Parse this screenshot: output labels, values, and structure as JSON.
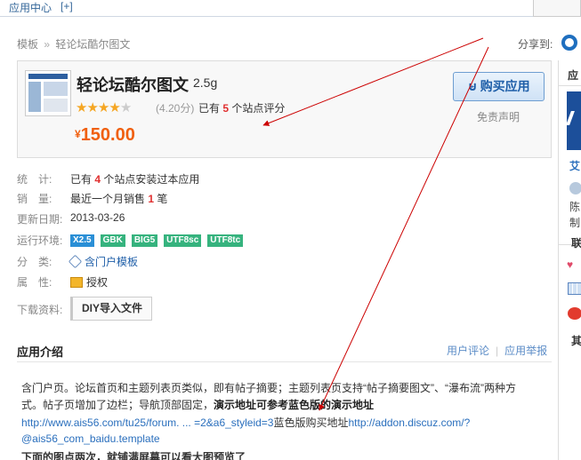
{
  "topbar": {
    "title": "应用中心",
    "add": "[+]"
  },
  "breadcrumb": {
    "home": "模板",
    "separator": "»",
    "current": "轻论坛酷尔图文"
  },
  "share": {
    "label": "分享到:",
    "icon": "qq-icon"
  },
  "app": {
    "name": "轻论坛酷尔图文",
    "size": "2.5g",
    "rating_stars_filled": 4,
    "rating_stars_total": 5,
    "rating_score": "(4.20分)",
    "rating_prefix": "已有",
    "rating_count": "5",
    "rating_suffix": "个站点评分",
    "currency": "¥",
    "price": "150.00",
    "buy_label": "购买应用",
    "disclaimer": "免责声明"
  },
  "info": {
    "stats": {
      "label": "统　计:",
      "prefix": "已有",
      "count": "4",
      "suffix": "个站点安装过本应用"
    },
    "sales": {
      "label": "销　量:",
      "prefix": "最近一个月销售",
      "count": "1",
      "suffix": "笔"
    },
    "updated": {
      "label": "更新日期:",
      "value": "2013-03-26"
    },
    "env": {
      "label": "运行环境:",
      "badges": [
        "X2.5",
        "GBK",
        "BIG5",
        "UTF8sc",
        "UTF8tc"
      ]
    },
    "category": {
      "label": "分　类:",
      "value": "含门户模板"
    },
    "attribute": {
      "label": "属　性:",
      "value": "授权"
    },
    "download": {
      "label": "下载资料:",
      "button": "DIY导入文件"
    }
  },
  "intro": {
    "title": "应用介绍",
    "review_link": "用户评论",
    "report_link": "应用举报",
    "line1": "含门户页。论坛首页和主题列表页类似，即有帖子摘要；主题列表页支持“帖子摘要图文”、“瀑布流”两种方",
    "line2_a": "式。帖子页增加了边栏；导航顶部固定，",
    "line2_b": "演示地址可参考蓝色版的演示地址",
    "line3_url1": "http://www.ais56.com/tu25/forum. ... =2&a6_styleid=3",
    "line3_text": "蓝色版购买地址",
    "line3_url2": "http://addon.discuz.com/?",
    "line4_url": "@ais56_com_baidu.template",
    "line5": "下面的图点两次，就铺满屏幕可以看大图预览了"
  },
  "sidebar": {
    "title": "应",
    "name": "艾",
    "text1": "陈",
    "text2": "制,",
    "section1": "联",
    "section2": "其"
  },
  "colors": {
    "price": "#f06010",
    "link": "#2a6fbd",
    "highlight": "#e03030",
    "arrow": "#cc0000",
    "badges": [
      "#2a8fd6",
      "#36b37e",
      "#36b37e",
      "#36b37e",
      "#36b37e"
    ]
  }
}
